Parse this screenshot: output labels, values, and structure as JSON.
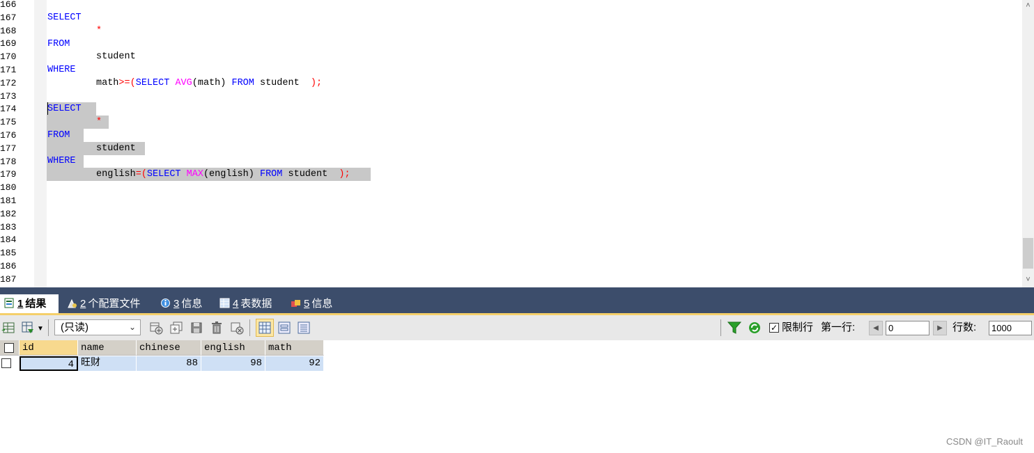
{
  "editor": {
    "line_numbers": [
      "166",
      "167",
      "168",
      "169",
      "170",
      "171",
      "172",
      "173",
      "174",
      "175",
      "176",
      "177",
      "178",
      "179",
      "180",
      "181",
      "182",
      "183",
      "184",
      "185",
      "186",
      "187"
    ],
    "query1": {
      "l167": "SELECT",
      "l168": "*",
      "l169": "FROM",
      "l170": "student",
      "l171": "WHERE",
      "l172_a": "math",
      "l172_b": ">=(",
      "l172_c": "SELECT",
      "l172_d": "AVG",
      "l172_e": "(math)",
      "l172_f": "FROM",
      "l172_g": "student",
      "l172_h": ");"
    },
    "query2": {
      "l174": "SELECT",
      "l175": "*",
      "l176": "FROM",
      "l177": "student",
      "l178": "WHERE",
      "l179_a": "english",
      "l179_b": "=(",
      "l179_c": "SELECT",
      "l179_d": "MAX",
      "l179_e": "(english)",
      "l179_f": "FROM",
      "l179_g": "student",
      "l179_h": ");"
    }
  },
  "tabs": [
    {
      "num": "1",
      "label": "结果",
      "active": true,
      "icon": "results-icon"
    },
    {
      "num": "2",
      "label": "个配置文件",
      "active": false,
      "icon": "profile-icon"
    },
    {
      "num": "3",
      "label": "信息",
      "active": false,
      "icon": "info-icon"
    },
    {
      "num": "4",
      "label": "表数据",
      "active": false,
      "icon": "table-data-icon"
    },
    {
      "num": "5",
      "label": "信息",
      "active": false,
      "icon": "info2-icon"
    }
  ],
  "toolbar": {
    "mode": "(只读)",
    "limit_label": "限制行",
    "limit_checked": true,
    "first_row_label": "第一行:",
    "first_row_value": "0",
    "rows_label": "行数:",
    "rows_value": "1000"
  },
  "grid": {
    "columns": [
      "id",
      "name",
      "chinese",
      "english",
      "math"
    ],
    "rows": [
      [
        "4",
        "旺财",
        "88",
        "98",
        "92"
      ]
    ]
  },
  "watermark": "CSDN @IT_Raoult",
  "colors": {
    "keyword": "#0000ff",
    "function": "#ff00ff",
    "operator": "#ff0000",
    "selection": "#c8c8c8",
    "tab_bar": "#3c4d6b",
    "grid_cell": "#cfe0f5"
  }
}
